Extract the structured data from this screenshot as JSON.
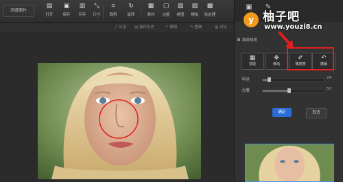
{
  "toolbar": {
    "browse_label": "浏览图片",
    "tools": [
      {
        "label": "打开",
        "icon": "folder-icon"
      },
      {
        "label": "保存",
        "icon": "save-icon"
      },
      {
        "label": "另存",
        "icon": "save-as-icon"
      },
      {
        "label": "尺寸",
        "icon": "resize-icon"
      },
      {
        "label": "裁剪",
        "icon": "crop-icon"
      },
      {
        "label": "旋转",
        "icon": "rotate-icon"
      },
      {
        "label": "素材",
        "icon": "material-icon"
      },
      {
        "label": "边框",
        "icon": "frame-icon"
      },
      {
        "label": "拼图",
        "icon": "collage-icon"
      },
      {
        "label": "模板",
        "icon": "template-icon"
      },
      {
        "label": "批处理",
        "icon": "batch-icon"
      }
    ]
  },
  "subbar": {
    "share": "分享",
    "history": "操作历史",
    "undo": "撤销",
    "redo": "重做",
    "compare": "对比"
  },
  "logo": {
    "title": "柚子吧",
    "url": "www.youzi8.cn",
    "badge": "y"
  },
  "panel": {
    "section_title": "局部祛斑",
    "buttons": [
      {
        "label": "祛斑",
        "icon": "spot-icon"
      },
      {
        "label": "移动",
        "icon": "move-icon"
      },
      {
        "label": "橡皮擦",
        "icon": "eraser-icon"
      },
      {
        "label": "撤销",
        "icon": "undo-icon"
      }
    ],
    "sliders": [
      {
        "label": "半径",
        "value": "24",
        "fraction": 0.1
      },
      {
        "label": "力度",
        "value": "50",
        "fraction": 0.42
      }
    ],
    "apply": "确定",
    "cancel": "取消"
  },
  "colors": {
    "accent": "#2b6dd6",
    "highlight": "#e02020",
    "logo_orange": "#f39a1c"
  }
}
